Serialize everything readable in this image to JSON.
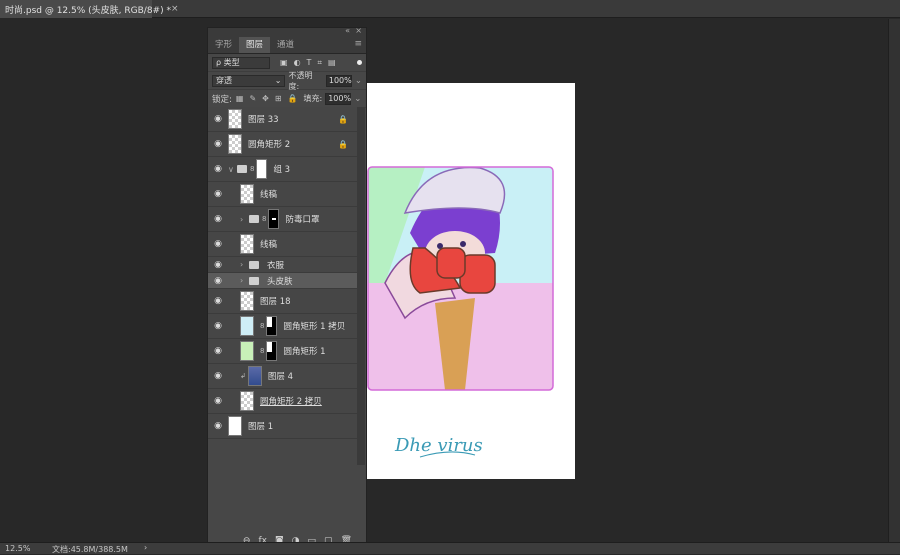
{
  "document_tab": {
    "title": "时尚.psd @ 12.5% (头皮肤, RGB/8#) *",
    "close": "×"
  },
  "status": {
    "zoom": "12.5%",
    "doc": "文档:45.8M/388.5M",
    "arrow": "›"
  },
  "panel": {
    "collapse": "«",
    "close": "×",
    "menu": "≡",
    "tabs": [
      {
        "label": "字形"
      },
      {
        "label": "图层"
      },
      {
        "label": "通道"
      }
    ],
    "filter": {
      "label": "ρ 类型",
      "icons": [
        "▣",
        "◐",
        "T",
        "⌗",
        "▤"
      ]
    },
    "blend_mode": "穿透",
    "opacity_label": "不透明度:",
    "opacity_value": "100%",
    "lock_label": "锁定:",
    "lock_icons": [
      "▦",
      "✎",
      "✥",
      "⊞",
      "🔒"
    ],
    "fill_label": "填充:",
    "fill_value": "100%",
    "layers": [
      {
        "name": "图层 33",
        "lock": "🔒"
      },
      {
        "name": "圆角矩形 2",
        "lock": "🔒"
      },
      {
        "name": "组 3",
        "chev": "∨",
        "chain": "8"
      },
      {
        "name": "线稿"
      },
      {
        "name": "防毒口罩",
        "chev": "›",
        "chain": "8"
      },
      {
        "name": "线稿"
      },
      {
        "name": "衣服",
        "chev": "›"
      },
      {
        "name": "头皮肤",
        "chev": "›"
      },
      {
        "name": "图层 18"
      },
      {
        "name": "圆角矩形 1 拷贝",
        "chain": "8"
      },
      {
        "name": "圆角矩形 1",
        "chain": "8"
      },
      {
        "name": "图层 4",
        "chain": "↲"
      },
      {
        "name": "圆角矩形 2 拷贝"
      },
      {
        "name": "图层 1"
      }
    ],
    "bottom_icons": [
      "⊖",
      "fx",
      "◙",
      "◑",
      "▭",
      "▢",
      "🗑"
    ]
  },
  "artwork": {
    "signature": "Dhe virus",
    "accent_pink": "#e9b3f0",
    "accent_mint": "#b6f0c3",
    "accent_cyan": "#c9f0f6",
    "mask_red": "#e8463f",
    "hair_purple": "#7b3fd0"
  }
}
